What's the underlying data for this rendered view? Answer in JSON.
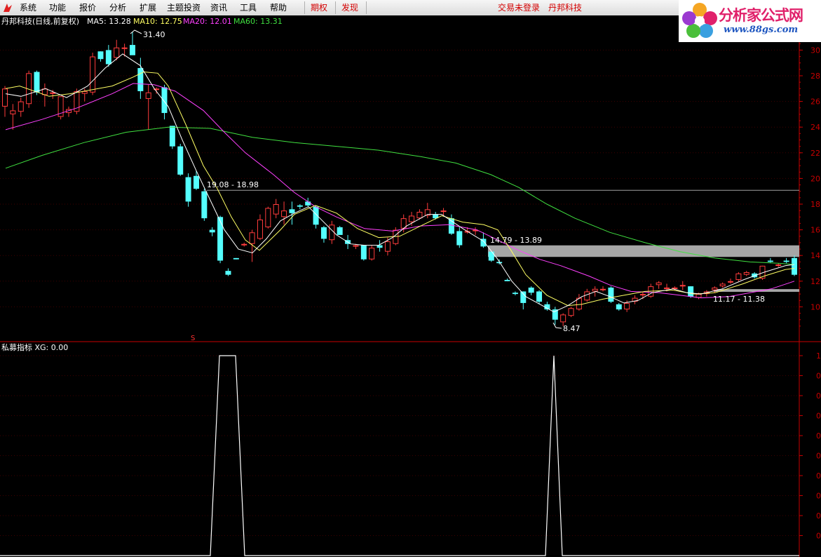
{
  "menubar": {
    "items": [
      "系统",
      "功能",
      "报价",
      "分析",
      "扩展",
      "主题投资",
      "资讯",
      "工具",
      "帮助"
    ],
    "red_items": [
      "期权",
      "发现"
    ],
    "status": "交易未登录",
    "brand": "丹邦科技"
  },
  "logo": {
    "text": "分析家公式网",
    "url": "www.88gs.com"
  },
  "colors": {
    "up": "#ff3c3c",
    "down": "#54ffff",
    "ma5": "#ffffff",
    "ma10": "#ffff64",
    "ma20": "#ff40ff",
    "ma60": "#40e040",
    "axis": "#c80000",
    "background": "#000000"
  },
  "price_panel": {
    "title": "丹邦科技(日线,前复权)",
    "ma_labels": [
      {
        "label": "MA5: 13.28",
        "color": "#ffffff"
      },
      {
        "label": "MA10: 12.75",
        "color": "#ffff64"
      },
      {
        "label": "MA20: 12.01",
        "color": "#ff40ff"
      },
      {
        "label": "MA60: 13.31",
        "color": "#40e040"
      }
    ],
    "annotations": {
      "high": "31.40",
      "low": "8.47",
      "zone1": "19.08 - 18.98",
      "zone2": "14.79 - 13.89",
      "zone3": "11.17 - 11.38",
      "marker": "S"
    },
    "y_ticks": [
      "30",
      "28",
      "26",
      "24",
      "22",
      "20",
      "18",
      "16",
      "14",
      "12",
      "10"
    ]
  },
  "indicator_panel": {
    "title": "私募指标 XG: 0.00",
    "y_ticks": [
      "1",
      "0",
      "0",
      "0",
      "0",
      "0",
      "0",
      "0",
      "0",
      "0"
    ]
  },
  "chart_data": {
    "type": "candlestick",
    "y_range": [
      8,
      30.8
    ],
    "ohlc": [
      [
        25.6,
        27.2,
        24.8,
        27.0
      ],
      [
        25.0,
        25.8,
        23.8,
        25.3
      ],
      [
        25.2,
        26.3,
        24.8,
        26.0
      ],
      [
        25.8,
        28.4,
        25.5,
        28.2
      ],
      [
        28.3,
        28.4,
        26.5,
        26.7
      ],
      [
        26.5,
        27.4,
        25.6,
        27.0
      ],
      [
        26.6,
        26.9,
        26.2,
        26.7
      ],
      [
        24.8,
        26.4,
        24.6,
        26.4
      ],
      [
        25.1,
        25.6,
        24.8,
        25.4
      ],
      [
        25.2,
        27.0,
        25.0,
        26.8
      ],
      [
        26.6,
        27.0,
        26.0,
        26.8
      ],
      [
        26.7,
        29.8,
        26.5,
        29.5
      ],
      [
        29.9,
        29.9,
        29.1,
        29.3
      ],
      [
        30.0,
        30.4,
        28.7,
        28.9
      ],
      [
        29.4,
        30.8,
        29.2,
        30.2
      ],
      [
        30.2,
        30.5,
        29.5,
        30.2
      ],
      [
        30.4,
        31.4,
        29.8,
        29.6
      ],
      [
        28.6,
        29.4,
        26.2,
        26.8
      ],
      [
        26.2,
        27.3,
        23.8,
        26.7
      ],
      [
        26.9,
        27.1,
        26.6,
        27.0
      ],
      [
        27.1,
        27.3,
        24.6,
        25.1
      ],
      [
        24.1,
        24.1,
        22.3,
        22.5
      ],
      [
        22.5,
        22.7,
        20.2,
        20.3
      ],
      [
        20.1,
        20.4,
        17.8,
        18.2
      ],
      [
        20.2,
        20.6,
        19.1,
        19.2
      ],
      [
        19.0,
        19.2,
        16.7,
        16.9
      ],
      [
        16.0,
        16.2,
        15.5,
        15.8
      ],
      [
        17.0,
        17.1,
        13.4,
        13.6
      ],
      [
        12.8,
        13.0,
        12.4,
        12.5
      ],
      [
        13.8,
        13.8,
        13.7,
        13.7
      ],
      [
        14.8,
        15.0,
        14.7,
        14.9
      ],
      [
        14.9,
        16.0,
        13.5,
        15.8
      ],
      [
        15.3,
        17.2,
        15.2,
        16.8
      ],
      [
        16.2,
        17.8,
        16.1,
        17.7
      ],
      [
        17.2,
        18.4,
        16.9,
        18.0
      ],
      [
        17.0,
        18.2,
        16.4,
        17.5
      ],
      [
        17.6,
        18.2,
        16.4,
        17.3
      ],
      [
        17.9,
        18.0,
        17.6,
        17.8
      ],
      [
        18.2,
        18.5,
        17.8,
        17.9
      ],
      [
        17.8,
        17.9,
        16.1,
        16.4
      ],
      [
        16.2,
        16.3,
        15.0,
        15.3
      ],
      [
        15.2,
        16.7,
        14.9,
        16.4
      ],
      [
        16.2,
        16.3,
        15.6,
        15.6
      ],
      [
        15.2,
        15.6,
        14.5,
        14.9
      ],
      [
        14.7,
        14.9,
        14.5,
        14.8
      ],
      [
        14.8,
        14.8,
        13.6,
        13.7
      ],
      [
        13.7,
        14.8,
        13.6,
        14.6
      ],
      [
        14.8,
        15.2,
        14.3,
        14.6
      ],
      [
        14.3,
        15.4,
        14.0,
        15.1
      ],
      [
        14.9,
        16.2,
        14.8,
        16.0
      ],
      [
        16.1,
        17.2,
        15.8,
        16.9
      ],
      [
        16.6,
        17.4,
        16.3,
        17.1
      ],
      [
        16.9,
        17.6,
        16.8,
        17.4
      ],
      [
        17.1,
        18.1,
        16.9,
        17.6
      ],
      [
        17.2,
        17.4,
        16.8,
        16.9
      ],
      [
        17.4,
        17.7,
        17.1,
        17.5
      ],
      [
        16.9,
        17.2,
        15.6,
        15.7
      ],
      [
        15.9,
        16.2,
        14.6,
        14.8
      ],
      [
        15.9,
        16.2,
        15.7,
        15.9
      ],
      [
        16.0,
        16.2,
        15.6,
        16.0
      ],
      [
        15.3,
        15.8,
        14.6,
        14.7
      ],
      [
        14.3,
        14.3,
        13.5,
        13.6
      ],
      [
        13.5,
        13.7,
        13.3,
        13.4
      ],
      [
        12.1,
        12.2,
        12.0,
        12.0
      ],
      [
        11.1,
        11.2,
        10.9,
        11.0
      ],
      [
        11.2,
        11.2,
        9.8,
        10.3
      ],
      [
        11.5,
        11.6,
        10.9,
        11.1
      ],
      [
        11.2,
        11.3,
        10.2,
        10.4
      ],
      [
        10.2,
        10.4,
        9.7,
        9.8
      ],
      [
        9.8,
        10.0,
        8.6,
        9.0
      ],
      [
        8.8,
        9.5,
        8.5,
        9.4
      ],
      [
        9.3,
        10.0,
        9.2,
        9.9
      ],
      [
        9.8,
        11.0,
        9.7,
        10.7
      ],
      [
        10.5,
        11.4,
        10.4,
        11.2
      ],
      [
        11.2,
        11.6,
        10.8,
        11.4
      ],
      [
        11.3,
        11.6,
        11.2,
        11.4
      ],
      [
        11.5,
        11.6,
        10.3,
        10.4
      ],
      [
        10.2,
        10.3,
        9.7,
        9.8
      ],
      [
        9.8,
        10.5,
        9.6,
        10.3
      ],
      [
        10.4,
        10.9,
        10.2,
        10.7
      ],
      [
        10.9,
        11.2,
        10.6,
        11.0
      ],
      [
        10.8,
        11.8,
        10.7,
        11.6
      ],
      [
        11.7,
        12.0,
        11.4,
        11.9
      ],
      [
        11.5,
        11.8,
        11.2,
        11.5
      ],
      [
        11.4,
        11.6,
        11.3,
        11.5
      ],
      [
        11.6,
        12.0,
        11.3,
        11.7
      ],
      [
        11.6,
        11.6,
        10.7,
        10.8
      ],
      [
        10.7,
        11.1,
        10.6,
        11.0
      ],
      [
        11.0,
        11.3,
        10.8,
        11.2
      ],
      [
        11.3,
        11.6,
        11.1,
        11.5
      ],
      [
        11.6,
        11.9,
        11.5,
        11.8
      ],
      [
        11.9,
        12.2,
        11.8,
        12.0
      ],
      [
        12.1,
        12.7,
        12.0,
        12.6
      ],
      [
        12.5,
        12.8,
        12.4,
        12.7
      ],
      [
        12.6,
        12.7,
        12.2,
        12.3
      ],
      [
        12.2,
        13.2,
        12.1,
        13.2
      ],
      [
        13.6,
        13.8,
        13.4,
        13.5
      ],
      [
        13.2,
        13.4,
        13.1,
        13.3
      ],
      [
        13.6,
        13.8,
        13.4,
        13.5
      ],
      [
        13.8,
        14.0,
        12.4,
        12.5
      ]
    ],
    "ma10": [
      [
        8,
        27.0
      ],
      [
        28,
        27.2
      ],
      [
        70,
        26.4
      ],
      [
        100,
        26.6
      ],
      [
        130,
        26.9
      ],
      [
        160,
        27.2
      ],
      [
        190,
        27.9
      ],
      [
        205,
        28.3
      ],
      [
        225,
        28.2
      ],
      [
        240,
        27.2
      ],
      [
        265,
        24.2
      ],
      [
        290,
        21.0
      ],
      [
        310,
        19.2
      ],
      [
        330,
        17.0
      ],
      [
        350,
        15.2
      ],
      [
        370,
        14.4
      ],
      [
        400,
        16.0
      ],
      [
        420,
        17.2
      ],
      [
        450,
        17.9
      ],
      [
        480,
        17.3
      ],
      [
        510,
        16.1
      ],
      [
        540,
        15.4
      ],
      [
        570,
        15.5
      ],
      [
        600,
        16.3
      ],
      [
        630,
        17.1
      ],
      [
        660,
        16.6
      ],
      [
        690,
        16.4
      ],
      [
        710,
        16.0
      ],
      [
        730,
        14.3
      ],
      [
        750,
        12.5
      ],
      [
        780,
        10.9
      ],
      [
        810,
        10.1
      ],
      [
        830,
        10.2
      ],
      [
        860,
        10.6
      ],
      [
        890,
        10.9
      ],
      [
        920,
        11.2
      ],
      [
        960,
        11.3
      ],
      [
        990,
        11.0
      ],
      [
        1020,
        11.1
      ],
      [
        1060,
        11.8
      ],
      [
        1090,
        12.4
      ],
      [
        1120,
        12.9
      ],
      [
        1133,
        13.0
      ]
    ],
    "ma5": [
      [
        8,
        26.6
      ],
      [
        30,
        26.4
      ],
      [
        65,
        27.0
      ],
      [
        95,
        26.3
      ],
      [
        125,
        27.2
      ],
      [
        150,
        28.6
      ],
      [
        175,
        29.7
      ],
      [
        200,
        28.8
      ],
      [
        220,
        27.0
      ],
      [
        240,
        25.6
      ],
      [
        260,
        23.0
      ],
      [
        280,
        20.6
      ],
      [
        300,
        18.3
      ],
      [
        320,
        16.0
      ],
      [
        340,
        14.5
      ],
      [
        360,
        14.2
      ],
      [
        380,
        15.3
      ],
      [
        400,
        16.7
      ],
      [
        420,
        17.3
      ],
      [
        440,
        17.8
      ],
      [
        460,
        16.7
      ],
      [
        480,
        15.6
      ],
      [
        500,
        14.9
      ],
      [
        520,
        14.8
      ],
      [
        540,
        14.8
      ],
      [
        560,
        15.4
      ],
      [
        580,
        16.3
      ],
      [
        610,
        17.2
      ],
      [
        630,
        17.2
      ],
      [
        660,
        16.1
      ],
      [
        690,
        15.1
      ],
      [
        710,
        13.7
      ],
      [
        730,
        12.0
      ],
      [
        750,
        10.8
      ],
      [
        770,
        10.2
      ],
      [
        790,
        9.6
      ],
      [
        810,
        10.1
      ],
      [
        830,
        10.8
      ],
      [
        850,
        11.2
      ],
      [
        870,
        10.8
      ],
      [
        890,
        10.3
      ],
      [
        910,
        10.5
      ],
      [
        930,
        11.1
      ],
      [
        960,
        11.4
      ],
      [
        980,
        11.1
      ],
      [
        1000,
        11.0
      ],
      [
        1030,
        11.4
      ],
      [
        1060,
        12.1
      ],
      [
        1090,
        12.7
      ],
      [
        1120,
        13.2
      ],
      [
        1133,
        13.3
      ]
    ],
    "ma20": [
      [
        8,
        23.8
      ],
      [
        60,
        24.6
      ],
      [
        110,
        25.5
      ],
      [
        160,
        26.6
      ],
      [
        190,
        27.4
      ],
      [
        220,
        27.3
      ],
      [
        250,
        26.8
      ],
      [
        290,
        25.3
      ],
      [
        320,
        23.6
      ],
      [
        350,
        22.0
      ],
      [
        390,
        20.3
      ],
      [
        420,
        18.9
      ],
      [
        450,
        17.8
      ],
      [
        480,
        17.0
      ],
      [
        520,
        16.1
      ],
      [
        560,
        15.9
      ],
      [
        600,
        16.3
      ],
      [
        640,
        16.4
      ],
      [
        680,
        16.0
      ],
      [
        710,
        15.2
      ],
      [
        740,
        14.4
      ],
      [
        770,
        13.7
      ],
      [
        800,
        13.2
      ],
      [
        840,
        12.4
      ],
      [
        870,
        11.7
      ],
      [
        900,
        11.2
      ],
      [
        940,
        11.1
      ],
      [
        970,
        10.9
      ],
      [
        1000,
        10.7
      ],
      [
        1040,
        10.8
      ],
      [
        1070,
        11.1
      ],
      [
        1100,
        11.4
      ],
      [
        1133,
        12.0
      ]
    ],
    "ma60": [
      [
        8,
        20.8
      ],
      [
        60,
        21.8
      ],
      [
        120,
        22.8
      ],
      [
        180,
        23.6
      ],
      [
        240,
        24.0
      ],
      [
        300,
        23.9
      ],
      [
        360,
        23.2
      ],
      [
        420,
        22.8
      ],
      [
        480,
        22.5
      ],
      [
        540,
        22.2
      ],
      [
        600,
        21.7
      ],
      [
        650,
        21.2
      ],
      [
        700,
        20.3
      ],
      [
        740,
        19.3
      ],
      [
        780,
        18.0
      ],
      [
        820,
        16.9
      ],
      [
        870,
        15.8
      ],
      [
        920,
        15.0
      ],
      [
        970,
        14.3
      ],
      [
        1020,
        13.8
      ],
      [
        1070,
        13.5
      ],
      [
        1110,
        13.4
      ],
      [
        1133,
        13.3
      ]
    ],
    "signal": [
      [
        0,
        0
      ],
      [
        300,
        0
      ],
      [
        313,
        1
      ],
      [
        336,
        1
      ],
      [
        349,
        0
      ],
      [
        778,
        0
      ],
      [
        790,
        1
      ],
      [
        802,
        0
      ],
      [
        1140,
        0
      ]
    ],
    "zones": [
      {
        "from": 19.08,
        "to": 18.98
      },
      {
        "from": 14.79,
        "to": 13.89
      },
      {
        "from": 11.17,
        "to": 11.38
      }
    ]
  }
}
